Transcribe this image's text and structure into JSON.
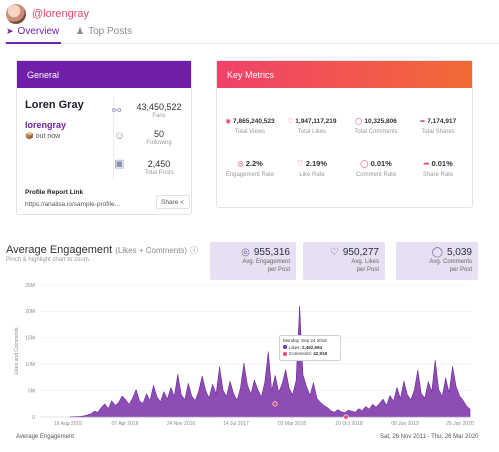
{
  "header": {
    "handle": "@lorengray"
  },
  "tabs": [
    {
      "label": "Overview",
      "icon": "rocket-icon"
    },
    {
      "label": "Top Posts",
      "icon": "trophy-icon"
    }
  ],
  "general": {
    "title": "General",
    "name": "Loren Gray",
    "username": "lorengray",
    "status": "📦 out now",
    "stats": [
      {
        "value": "43,450,522",
        "label": "Fans",
        "icon": "fans-icon"
      },
      {
        "value": "50",
        "label": "Following",
        "icon": "following-icon"
      },
      {
        "value": "2,450",
        "label": "Total Posts",
        "icon": "posts-icon"
      }
    ],
    "profile_link_label": "Profile Report Link",
    "profile_link": "https://analisa.io/sample-profile...",
    "share_label": "Share"
  },
  "metrics": {
    "title": "Key Metrics",
    "row1": [
      {
        "value": "7,865,240,523",
        "label": "Total Views",
        "icon": "eye-icon"
      },
      {
        "value": "1,947,117,219",
        "label": "Total Likes",
        "icon": "heart-icon"
      },
      {
        "value": "10,325,806",
        "label": "Total Comments",
        "icon": "comment-icon"
      },
      {
        "value": "7,174,917",
        "label": "Total Shares",
        "icon": "share-icon"
      }
    ],
    "row2": [
      {
        "value": "2.2%",
        "label": "Engagement Rate",
        "icon": "target-icon"
      },
      {
        "value": "2.19%",
        "label": "Like Rate",
        "icon": "heart-icon"
      },
      {
        "value": "0.01%",
        "label": "Comment Rate",
        "icon": "comment-icon"
      },
      {
        "value": "0.01%",
        "label": "Share Rate",
        "icon": "share-icon"
      }
    ]
  },
  "engagement": {
    "title": "Average Engagement",
    "title_suffix": "(Likes + Comments)",
    "subtitle": "Pinch & highlight chart to zoom.",
    "stats": [
      {
        "value": "955,316",
        "label1": "Avg. Engagement",
        "label2": "per Post",
        "icon": "target-icon"
      },
      {
        "value": "950,277",
        "label1": "Avg. Likes",
        "label2": "per Post",
        "icon": "heart-icon"
      },
      {
        "value": "5,039",
        "label1": "Avg. Comments",
        "label2": "per Post",
        "icon": "comment-icon"
      }
    ],
    "footer_left": "Average Engagement",
    "footer_right": "Sat, 26 Nov 2011 - Thu, 26 Mar 2020",
    "tooltip": {
      "date": "Monday, Sep 24 2018",
      "likes_label": "Likes",
      "likes_value": "2,492,694",
      "comments_label": "Comments",
      "comments_value": "42,918"
    }
  },
  "chart_data": {
    "type": "area",
    "ylabel": "Likes and Comments",
    "y_ticks": [
      "0",
      "5M",
      "10M",
      "15M",
      "20M",
      "25M"
    ],
    "ylim": [
      0,
      25000000
    ],
    "x_ticks": [
      "19 Aug 2015",
      "07 Apr 2016",
      "24 Nov 2016",
      "14 Jul 2017",
      "03 Mar 2018",
      "20 Oct 2018",
      "08 Jun 2019",
      "26 Jan 2020"
    ],
    "series": [
      {
        "name": "Likes",
        "color": "#7a2ea8",
        "values": [
          0.05,
          0.08,
          0.1,
          0.12,
          0.2,
          0.4,
          0.6,
          1.1,
          0.9,
          1.8,
          2.5,
          1.6,
          3.1,
          2.2,
          2.8,
          4.0,
          3.3,
          2.4,
          3.6,
          5.2,
          3.0,
          2.6,
          4.4,
          3.1,
          6.0,
          3.8,
          2.9,
          4.8,
          3.4,
          5.6,
          3.9,
          8.1,
          4.2,
          3.3,
          6.4,
          4.0,
          3.1,
          4.9,
          7.8,
          5.0,
          3.6,
          6.2,
          4.4,
          9.5,
          5.1,
          3.9,
          6.8,
          4.5,
          3.2,
          5.4,
          10.2,
          6.1,
          4.3,
          7.0,
          5.2,
          3.8,
          6.6,
          12.4,
          5.0,
          7.9,
          4.7,
          6.3,
          9.0,
          5.5,
          4.2,
          6.9,
          21.0,
          8.0,
          5.8,
          4.1,
          6.5,
          3.5,
          2.8,
          2.2,
          1.8,
          1.2,
          0.9,
          1.4,
          1.0,
          0.8,
          1.3,
          1.1,
          0.9,
          1.6,
          1.2,
          2.0,
          1.5,
          2.4,
          1.9,
          2.6,
          3.4,
          2.2,
          4.1,
          3.0,
          5.6,
          3.5,
          6.8,
          4.2,
          3.3,
          5.1,
          8.9,
          4.4,
          3.6,
          6.7,
          4.8,
          10.8,
          5.2,
          3.9,
          7.4,
          4.6,
          9.6,
          5.8,
          4.0,
          3.2,
          2.1,
          1.5
        ]
      }
    ],
    "markers": [
      {
        "x": "03 Mar 2018",
        "value": 2492694
      },
      {
        "x": "20 Oct 2018",
        "value": 0
      }
    ]
  }
}
